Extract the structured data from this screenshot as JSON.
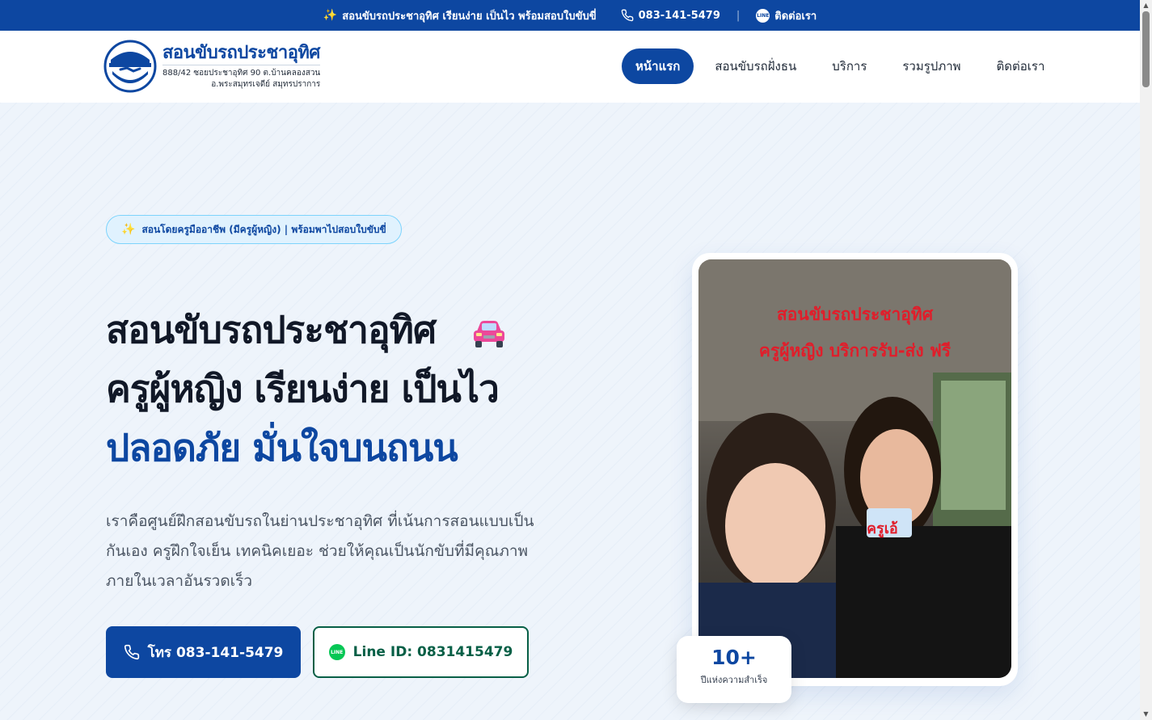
{
  "topbar": {
    "promo": "สอนขับรถประชาอุทิศ เรียนง่าย เป็นไว พร้อมสอบใบขับขี่",
    "phone": "083-141-5479",
    "separator": "|",
    "contact": "ติดต่อเรา",
    "line_badge": "LINE"
  },
  "logo": {
    "name": "สอนขับรถประชาอุทิศ",
    "address_line1": "888/42 ซอยประชาอุทิศ 90 ต.บ้านคลองสวน",
    "address_line2": "อ.พระสมุทรเจดีย์ สมุทรปราการ"
  },
  "nav": {
    "items": [
      {
        "label": "หน้าแรก"
      },
      {
        "label": "สอนขับรถฝั่งธน"
      },
      {
        "label": "บริการ"
      },
      {
        "label": "รวมรูปภาพ"
      },
      {
        "label": "ติดต่อเรา"
      }
    ]
  },
  "hero": {
    "badge": "สอนโดยครูมืออาชีพ (มีครูผู้หญิง) | พร้อมพาไปสอบใบขับขี่",
    "title_line1": "สอนขับรถประชาอุทิศ",
    "title_line2": "ครูผู้หญิง เรียนง่าย เป็นไว",
    "title_line3": "ปลอดภัย มั่นใจบนถนน",
    "description": "เราคือศูนย์ฝึกสอนขับรถในย่านประชาอุทิศ ที่เน้นการสอนแบบเป็นกันเอง ครูฝึกใจเย็น เทคนิคเยอะ ช่วยให้คุณเป็นนักขับที่มีคุณภาพภายในเวลาอันรวดเร็ว",
    "call_button": "โทร 083-141-5479",
    "line_button": "Line ID: 0831415479"
  },
  "photo": {
    "caption_line1": "สอนขับรถประชาอุทิศ",
    "caption_line2": "ครูผู้หญิง บริการรับ-ส่ง ฟรี",
    "card_text": "ครูเอ้"
  },
  "stat": {
    "number": "10+",
    "label": "ปีแห่งความสำเร็จ"
  },
  "colors": {
    "brand": "#0d47a1",
    "line_green": "#06c755",
    "caption_red": "#e11d2a"
  }
}
